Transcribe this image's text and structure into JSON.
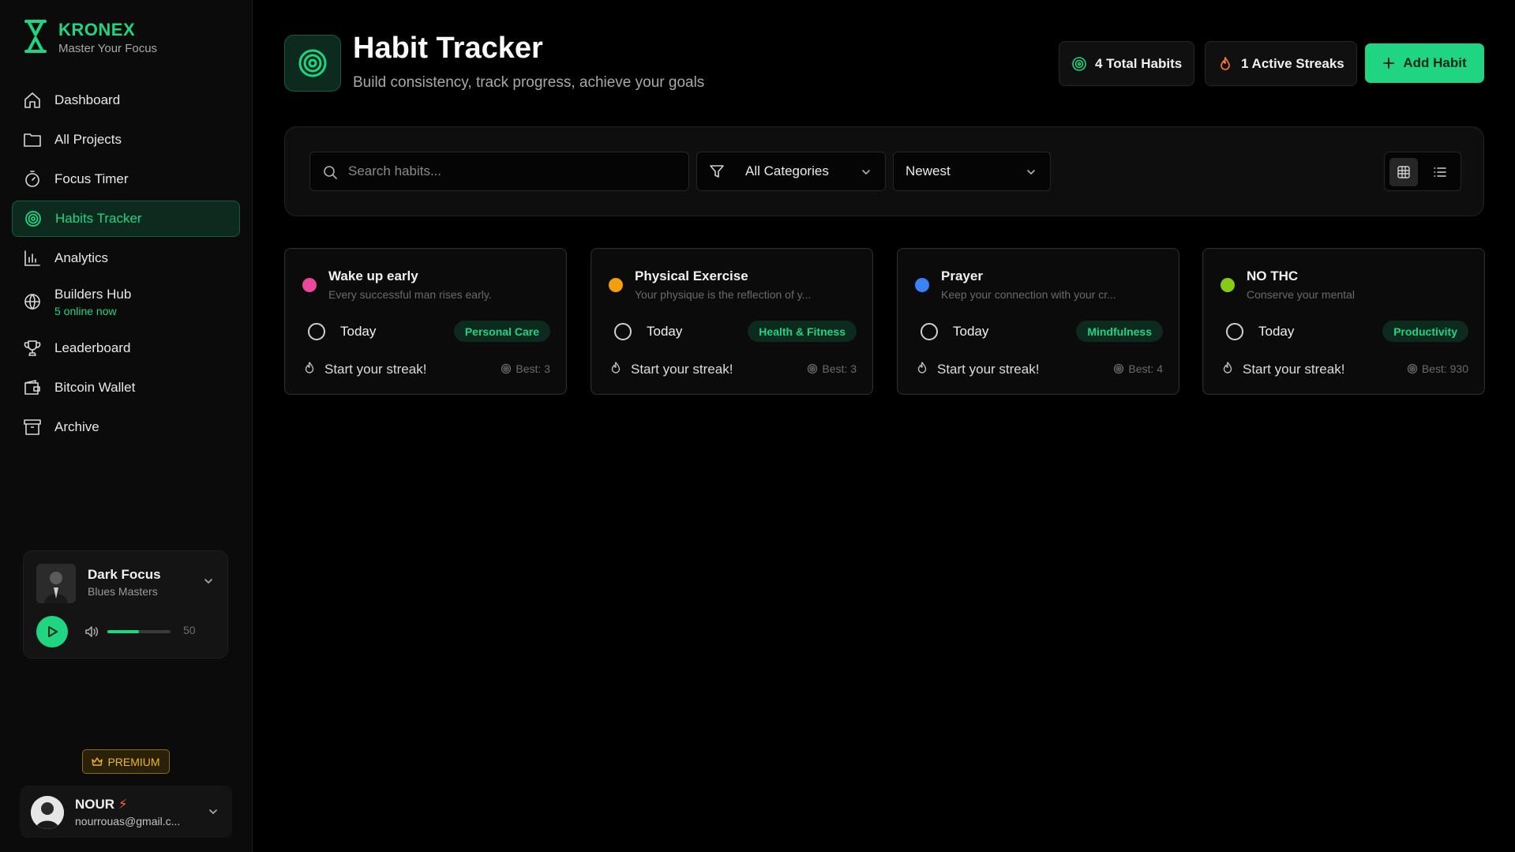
{
  "brand": {
    "name": "KRONEX",
    "tagline": "Master Your Focus"
  },
  "nav": [
    {
      "label": "Dashboard",
      "icon": "home-icon"
    },
    {
      "label": "All Projects",
      "icon": "folder-icon"
    },
    {
      "label": "Focus Timer",
      "icon": "timer-icon"
    },
    {
      "label": "Habits Tracker",
      "icon": "target-icon",
      "active": true
    },
    {
      "label": "Analytics",
      "icon": "bar-chart-icon"
    },
    {
      "label": "Builders Hub",
      "sub": "5 online now",
      "icon": "globe-icon"
    },
    {
      "label": "Leaderboard",
      "icon": "trophy-icon"
    },
    {
      "label": "Bitcoin Wallet",
      "icon": "wallet-icon"
    },
    {
      "label": "Archive",
      "icon": "archive-icon"
    }
  ],
  "player": {
    "title": "Dark Focus",
    "artist": "Blues Masters",
    "volume": 50
  },
  "premium_label": "PREMIUM",
  "user": {
    "name": "NOUR",
    "email": "nourrouas@gmail.c..."
  },
  "header": {
    "title": "Habit Tracker",
    "subtitle": "Build consistency, track progress, achieve your goals",
    "total_habits": "4 Total Habits",
    "active_streaks": "1 Active Streaks",
    "add_button": "Add Habit"
  },
  "filters": {
    "search_placeholder": "Search habits...",
    "category": "All Categories",
    "sort": "Newest"
  },
  "habits": [
    {
      "title": "Wake up early",
      "desc": "Every successful man rises early.",
      "today": "Today",
      "category": "Personal Care",
      "streak": "Start your streak!",
      "best": "Best: 3",
      "color": "#ec4899"
    },
    {
      "title": "Physical Exercise",
      "desc": "Your physique is the reflection of y...",
      "today": "Today",
      "category": "Health & Fitness",
      "streak": "Start your streak!",
      "best": "Best: 3",
      "color": "#f59e0b"
    },
    {
      "title": "Prayer",
      "desc": "Keep your connection with your cr...",
      "today": "Today",
      "category": "Mindfulness",
      "streak": "Start your streak!",
      "best": "Best: 4",
      "color": "#3b82f6"
    },
    {
      "title": "NO THC",
      "desc": "Conserve your mental",
      "today": "Today",
      "category": "Productivity",
      "streak": "Start your streak!",
      "best": "Best: 930",
      "color": "#84cc16"
    }
  ],
  "accent": "#1fd582"
}
